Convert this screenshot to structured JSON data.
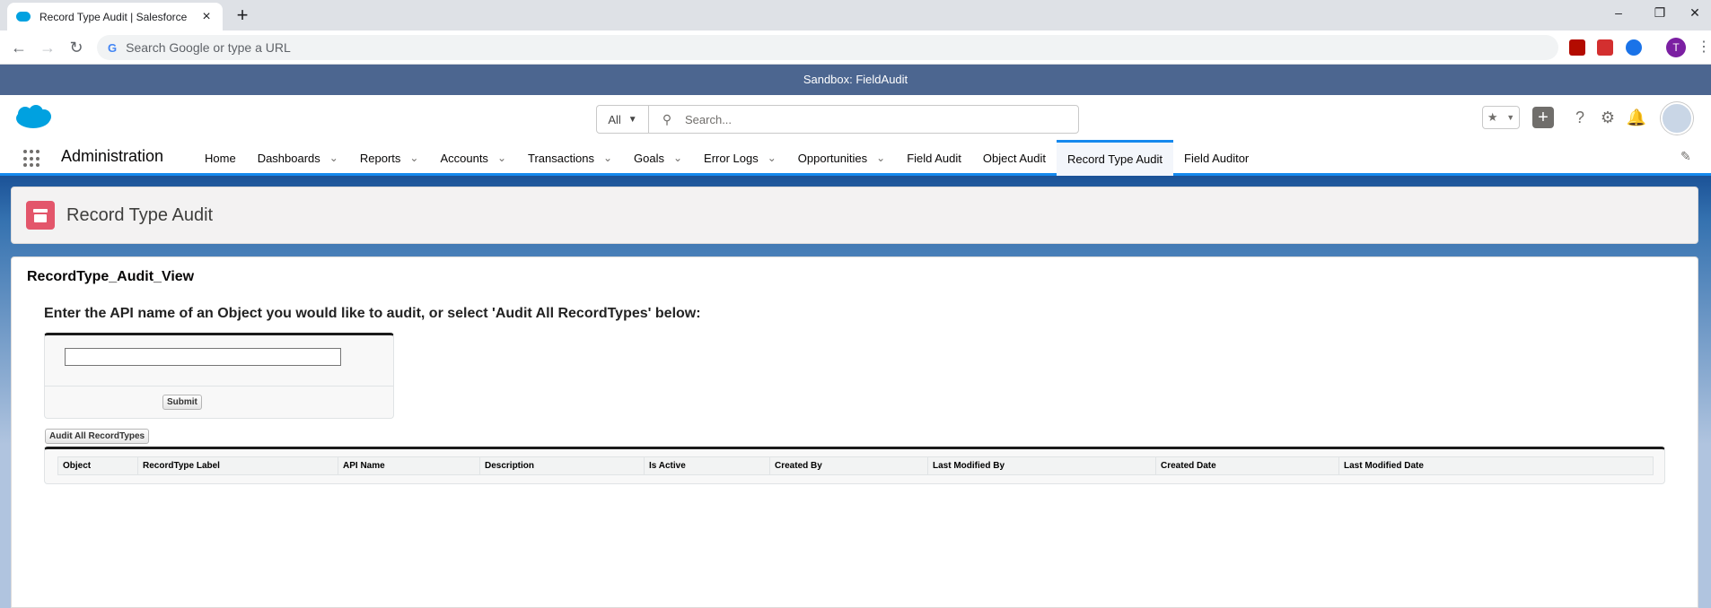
{
  "browser": {
    "tab_title": "Record Type Audit | Salesforce",
    "address_placeholder": "Search Google or type a URL",
    "profile_initial": "T"
  },
  "sandbox_banner": "Sandbox: FieldAudit",
  "header": {
    "search_scope": "All",
    "search_placeholder": "Search..."
  },
  "appnav": {
    "app_name": "Administration",
    "items": [
      {
        "label": "Home",
        "dropdown": false
      },
      {
        "label": "Dashboards",
        "dropdown": true
      },
      {
        "label": "Reports",
        "dropdown": true
      },
      {
        "label": "Accounts",
        "dropdown": true
      },
      {
        "label": "Transactions",
        "dropdown": true
      },
      {
        "label": "Goals",
        "dropdown": true
      },
      {
        "label": "Error Logs",
        "dropdown": true
      },
      {
        "label": "Opportunities",
        "dropdown": true
      },
      {
        "label": "Field Audit",
        "dropdown": false
      },
      {
        "label": "Object Audit",
        "dropdown": false
      },
      {
        "label": "Record Type Audit",
        "dropdown": false,
        "active": true
      },
      {
        "label": "Field Auditor",
        "dropdown": false
      }
    ]
  },
  "page": {
    "title": "Record Type Audit",
    "card_title": "RecordType_Audit_View",
    "prompt": "Enter the API name of an Object you would like to audit, or select 'Audit All RecordTypes' below:",
    "api_input_value": "",
    "submit_label": "Submit",
    "audit_all_label": "Audit All RecordTypes",
    "table_headers": [
      "Object",
      "RecordType Label",
      "API Name",
      "Description",
      "Is Active",
      "Created By",
      "Last Modified By",
      "Created Date",
      "Last Modified Date"
    ]
  },
  "colors": {
    "sandbox_bar": "#4c6690",
    "brand_blue": "#1589ee",
    "object_icon": "#e3566b"
  }
}
